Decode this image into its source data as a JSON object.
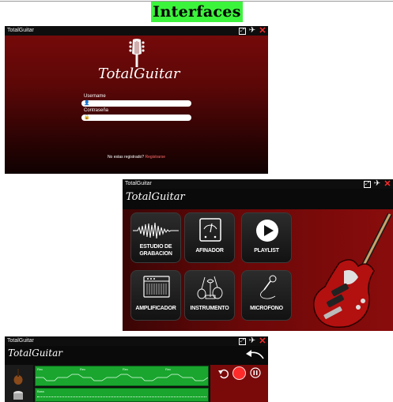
{
  "heading": "Interfaces",
  "login_window": {
    "title": "TotalGuitar",
    "logo_text": "TotalGuitar",
    "username_label": "Username",
    "password_label": "Contraseña",
    "register_prompt": "No estas registrado?",
    "register_link": "Registrarse"
  },
  "menu_window": {
    "title": "TotalGuitar",
    "logo_text": "TotalGuitar",
    "tiles": [
      {
        "label": "ESTUDIO DE GRABACION",
        "icon": "waveform-icon"
      },
      {
        "label": "AFINADOR",
        "icon": "tuner-icon"
      },
      {
        "label": "PLAYLIST",
        "icon": "play-icon"
      },
      {
        "label": "AMPLIFICADOR",
        "icon": "amplifier-icon"
      },
      {
        "label": "INSTRUMENTO",
        "icon": "instruments-icon"
      },
      {
        "label": "MICROFONO",
        "icon": "microphone-icon"
      }
    ]
  },
  "studio_window": {
    "title": "TotalGuitar",
    "logo_text": "TotalGuitar",
    "track_labels": [
      "Rec",
      "Rec",
      "Rec",
      "Rec"
    ],
    "bass_label": "Bass",
    "controls": [
      "undo-icon",
      "record-icon",
      "pause-icon",
      "back-arrow-icon"
    ]
  },
  "colors": {
    "accent_green": "#3cf43c",
    "brand_red": "#7a0a0a",
    "close_red": "#ff2a2a",
    "record_red": "#ff2b2b",
    "track_green": "#19a52e"
  }
}
